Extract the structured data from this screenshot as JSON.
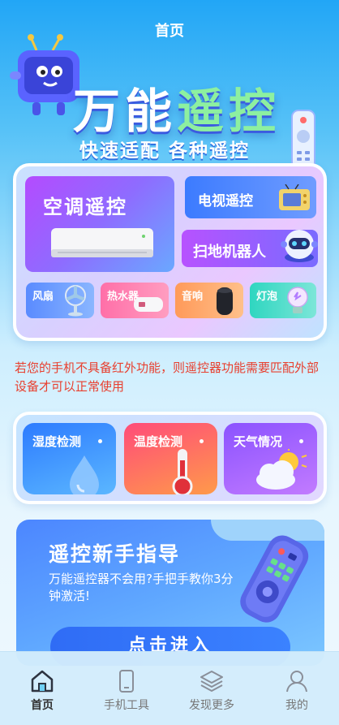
{
  "header": {
    "title": "首页"
  },
  "hero": {
    "title_main": "万能",
    "title_accent": "遥控",
    "subtitle": "快速适配 各种遥控"
  },
  "devices": {
    "primary": [
      {
        "label": "空调遥控",
        "icon": "air-conditioner-icon"
      },
      {
        "label": "电视遥控",
        "icon": "tv-icon"
      },
      {
        "label": "扫地机器人",
        "icon": "robot-icon"
      }
    ],
    "secondary": [
      {
        "label": "风扇",
        "icon": "fan-icon"
      },
      {
        "label": "热水器",
        "icon": "water-heater-icon"
      },
      {
        "label": "音响",
        "icon": "speaker-icon"
      },
      {
        "label": "灯泡",
        "icon": "light-bulb-icon"
      }
    ]
  },
  "notice": "若您的手机不具备红外功能，则遥控器功能需要匹配外部设备才可以正常使用",
  "sensors": [
    {
      "label": "湿度检测",
      "icon": "water-drop-icon"
    },
    {
      "label": "温度检测",
      "icon": "thermometer-icon"
    },
    {
      "label": "天气情况",
      "icon": "weather-icon"
    }
  ],
  "guide": {
    "title": "遥控新手指导",
    "description": "万能遥控器不会用?手把手教你3分钟激活!",
    "button": "点击进入"
  },
  "tabbar": [
    {
      "label": "首页",
      "icon": "home-icon",
      "active": true
    },
    {
      "label": "手机工具",
      "icon": "phone-icon",
      "active": false
    },
    {
      "label": "发现更多",
      "icon": "layers-icon",
      "active": false
    },
    {
      "label": "我的",
      "icon": "user-icon",
      "active": false
    }
  ],
  "colors": {
    "notice": "#e8402f",
    "primary_blue": "#2f6cf5",
    "accent_green": "#8df0a0"
  }
}
